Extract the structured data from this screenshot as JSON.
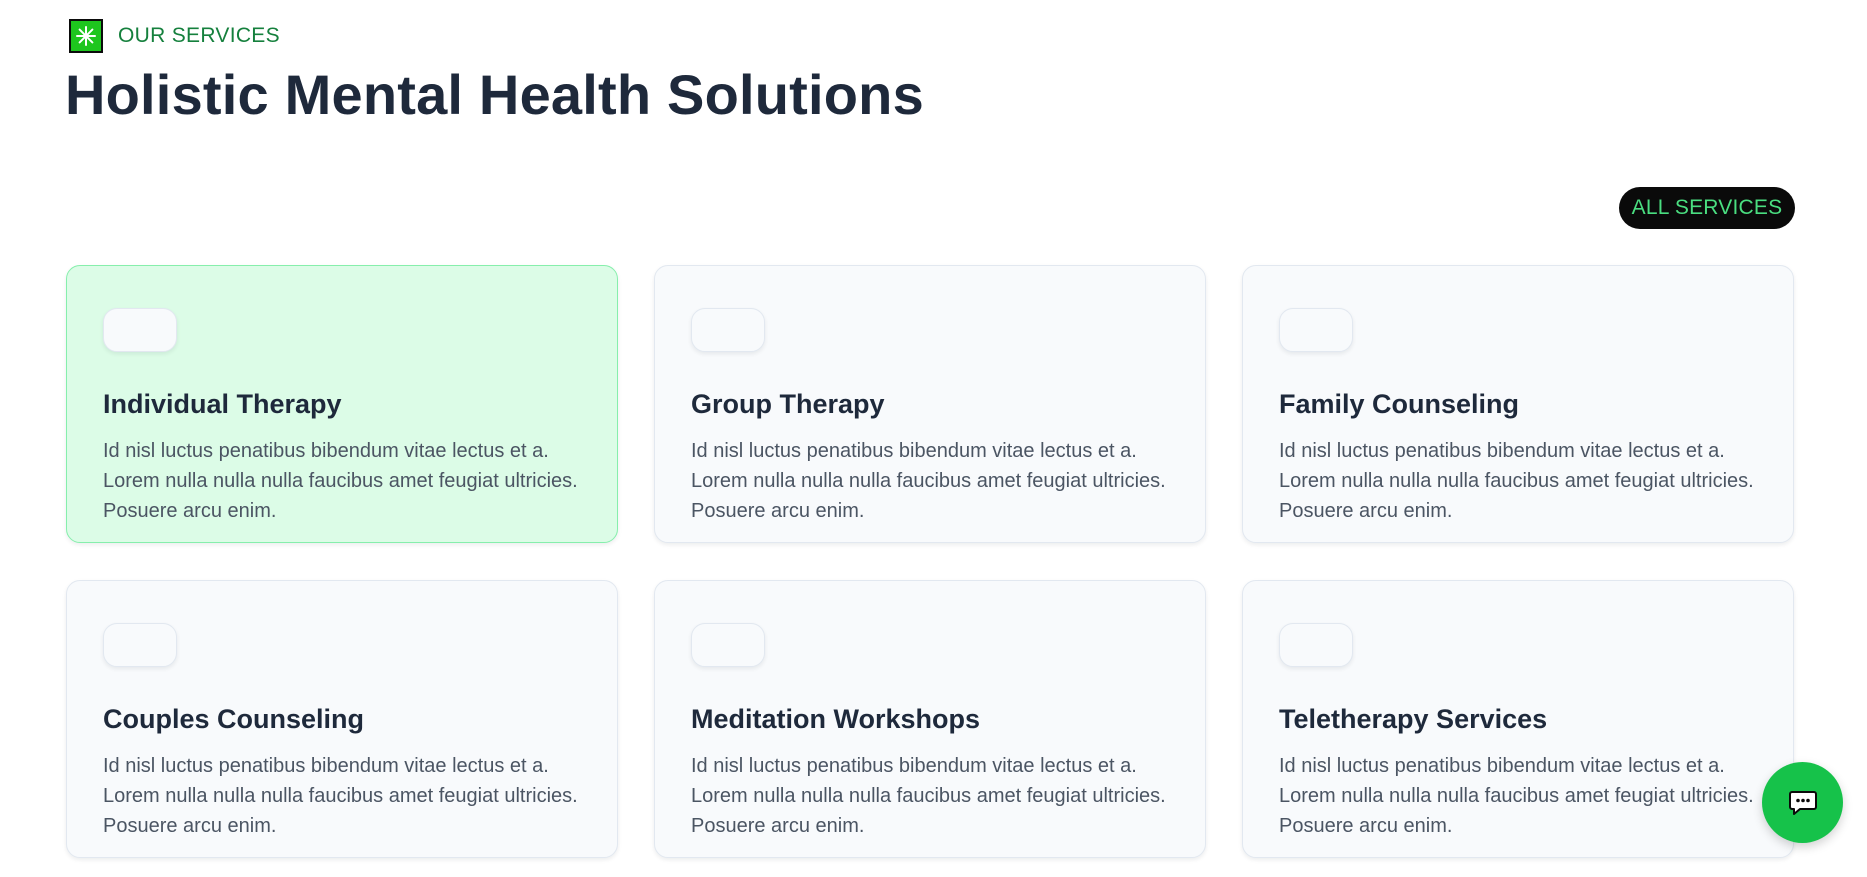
{
  "header": {
    "eyebrow_label": "OUR SERVICES",
    "title": "Holistic Mental Health Solutions",
    "all_services_label": "ALL SERVICES"
  },
  "services": [
    {
      "title": "Individual Therapy",
      "description": "Id nisl luctus penatibus bibendum vitae lectus et a. Lorem nulla nulla nulla faucibus amet feugiat ultricies. Posuere arcu enim.",
      "icon": "asterisk-icon",
      "highlighted": true
    },
    {
      "title": "Group Therapy",
      "description": "Id nisl luctus penatibus bibendum vitae lectus et a. Lorem nulla nulla nulla faucibus amet feugiat ultricies. Posuere arcu enim.",
      "icon": "asterisk-icon",
      "highlighted": false
    },
    {
      "title": "Family Counseling",
      "description": "Id nisl luctus penatibus bibendum vitae lectus et a. Lorem nulla nulla nulla faucibus amet feugiat ultricies. Posuere arcu enim.",
      "icon": "asterisk-icon",
      "highlighted": false
    },
    {
      "title": "Couples Counseling",
      "description": "Id nisl luctus penatibus bibendum vitae lectus et a. Lorem nulla nulla nulla faucibus amet feugiat ultricies. Posuere arcu enim.",
      "icon": "asterisk-icon",
      "highlighted": false
    },
    {
      "title": "Meditation Workshops",
      "description": "Id nisl luctus penatibus bibendum vitae lectus et a. Lorem nulla nulla nulla faucibus amet feugiat ultricies. Posuere arcu enim.",
      "icon": "asterisk-icon",
      "highlighted": false
    },
    {
      "title": "Teletherapy Services",
      "description": "Id nisl luctus penatibus bibendum vitae lectus et a. Lorem nulla nulla nulla faucibus amet feugiat ultricies. Posuere arcu enim.",
      "icon": "asterisk-icon",
      "highlighted": false
    }
  ],
  "chat_widget": {
    "icon": "chat-bubble-icon"
  },
  "colors": {
    "accent_green": "#1ec61e",
    "eyebrow_text": "#15803d",
    "title_text": "#1e293b",
    "button_bg": "#0a0a0a",
    "button_text": "#4ade80",
    "highlight_card_bg": "#dcfce7",
    "card_bg": "#f8fafc",
    "chat_button_bg": "#16c24a"
  }
}
